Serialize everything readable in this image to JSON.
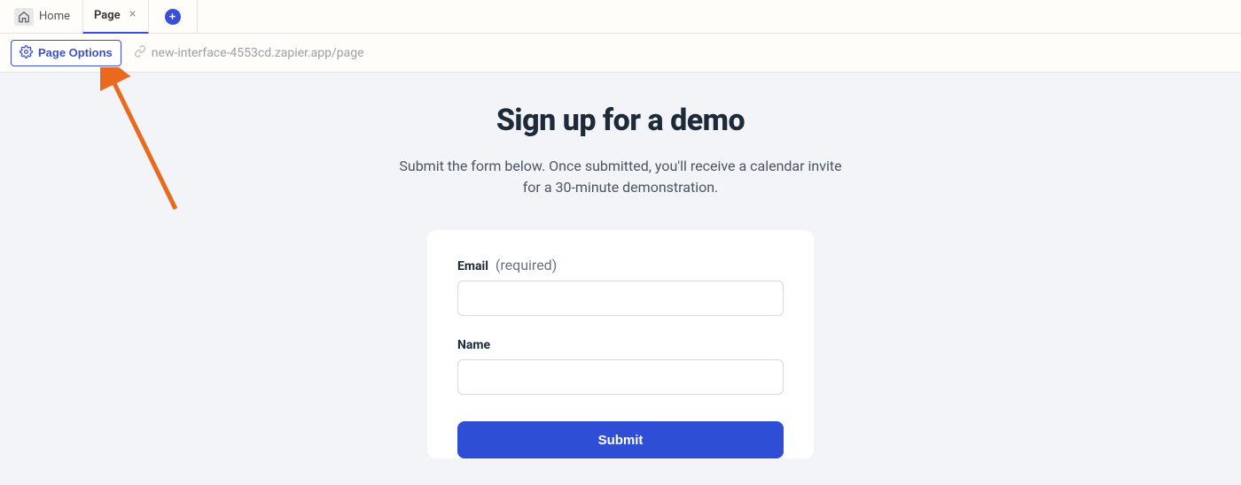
{
  "tabs": {
    "home_label": "Home",
    "page_label": "Page"
  },
  "toolbar": {
    "page_options_label": "Page Options",
    "url": "new-interface-4553cd.zapier.app/page"
  },
  "hero": {
    "title": "Sign up for a demo",
    "subtitle": "Submit the form below. Once submitted, you'll receive a calendar invite for a 30-minute demonstration."
  },
  "form": {
    "email_label": "Email",
    "email_required": "(required)",
    "name_label": "Name",
    "submit_label": "Submit"
  }
}
